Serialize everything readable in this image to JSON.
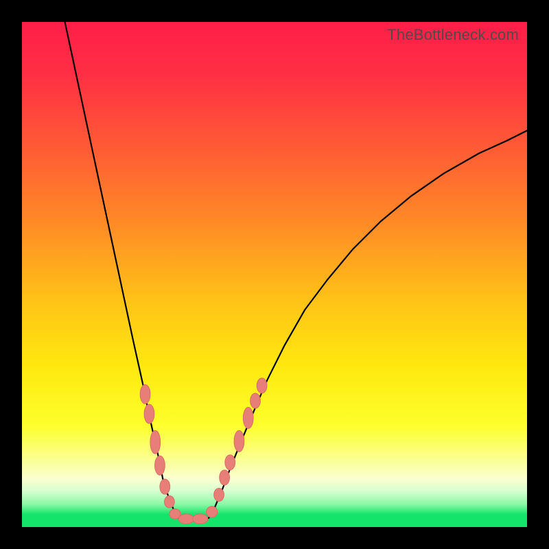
{
  "watermark": "TheBottleneck.com",
  "colors": {
    "frame": "#000000",
    "curve": "#000000",
    "marker_fill": "#e77f78",
    "marker_stroke": "#d86c65",
    "bottom_stripe": "#14e56a"
  },
  "gradient_stops": [
    {
      "offset": 0.0,
      "color": "#ff1e48"
    },
    {
      "offset": 0.1,
      "color": "#ff2e44"
    },
    {
      "offset": 0.25,
      "color": "#ff5b35"
    },
    {
      "offset": 0.4,
      "color": "#ff8b26"
    },
    {
      "offset": 0.55,
      "color": "#ffc217"
    },
    {
      "offset": 0.68,
      "color": "#ffe80e"
    },
    {
      "offset": 0.8,
      "color": "#fdff2c"
    },
    {
      "offset": 0.875,
      "color": "#fbffa0"
    },
    {
      "offset": 0.905,
      "color": "#fbffd2"
    },
    {
      "offset": 0.93,
      "color": "#d4ffce"
    },
    {
      "offset": 0.955,
      "color": "#8af9a6"
    },
    {
      "offset": 0.975,
      "color": "#14e56a"
    },
    {
      "offset": 1.0,
      "color": "#14e56a"
    }
  ],
  "chart_data": {
    "type": "line",
    "title": "",
    "xlabel": "",
    "ylabel": "",
    "xlim": [
      0,
      1
    ],
    "ylim": [
      0,
      1
    ],
    "series": [
      {
        "name": "left-branch",
        "x": [
          0.085,
          0.1,
          0.115,
          0.13,
          0.145,
          0.16,
          0.175,
          0.19,
          0.205,
          0.22,
          0.23,
          0.24,
          0.25,
          0.26,
          0.27,
          0.275,
          0.28,
          0.29,
          0.3,
          0.31
        ],
        "y": [
          1.0,
          0.93,
          0.86,
          0.79,
          0.72,
          0.65,
          0.58,
          0.51,
          0.44,
          0.37,
          0.325,
          0.28,
          0.23,
          0.185,
          0.14,
          0.115,
          0.09,
          0.06,
          0.035,
          0.018
        ]
      },
      {
        "name": "floor",
        "x": [
          0.31,
          0.34,
          0.37
        ],
        "y": [
          0.018,
          0.015,
          0.018
        ]
      },
      {
        "name": "right-branch",
        "x": [
          0.37,
          0.38,
          0.395,
          0.41,
          0.43,
          0.455,
          0.485,
          0.52,
          0.56,
          0.605,
          0.655,
          0.71,
          0.77,
          0.835,
          0.905,
          0.96,
          1.0
        ],
        "y": [
          0.018,
          0.035,
          0.07,
          0.11,
          0.16,
          0.22,
          0.29,
          0.36,
          0.43,
          0.49,
          0.55,
          0.605,
          0.655,
          0.7,
          0.74,
          0.765,
          0.785
        ]
      }
    ],
    "markers": [
      {
        "x": 0.244,
        "y": 0.263,
        "rx": 0.01,
        "ry": 0.019
      },
      {
        "x": 0.252,
        "y": 0.224,
        "rx": 0.01,
        "ry": 0.019
      },
      {
        "x": 0.264,
        "y": 0.168,
        "rx": 0.01,
        "ry": 0.023
      },
      {
        "x": 0.273,
        "y": 0.122,
        "rx": 0.01,
        "ry": 0.019
      },
      {
        "x": 0.283,
        "y": 0.08,
        "rx": 0.01,
        "ry": 0.015
      },
      {
        "x": 0.292,
        "y": 0.05,
        "rx": 0.01,
        "ry": 0.012
      },
      {
        "x": 0.303,
        "y": 0.026,
        "rx": 0.011,
        "ry": 0.01
      },
      {
        "x": 0.325,
        "y": 0.016,
        "rx": 0.015,
        "ry": 0.01
      },
      {
        "x": 0.353,
        "y": 0.016,
        "rx": 0.015,
        "ry": 0.01
      },
      {
        "x": 0.376,
        "y": 0.03,
        "rx": 0.011,
        "ry": 0.011
      },
      {
        "x": 0.39,
        "y": 0.064,
        "rx": 0.01,
        "ry": 0.013
      },
      {
        "x": 0.401,
        "y": 0.098,
        "rx": 0.01,
        "ry": 0.015
      },
      {
        "x": 0.412,
        "y": 0.128,
        "rx": 0.01,
        "ry": 0.015
      },
      {
        "x": 0.43,
        "y": 0.17,
        "rx": 0.01,
        "ry": 0.021
      },
      {
        "x": 0.448,
        "y": 0.216,
        "rx": 0.01,
        "ry": 0.021
      },
      {
        "x": 0.462,
        "y": 0.25,
        "rx": 0.01,
        "ry": 0.015
      },
      {
        "x": 0.475,
        "y": 0.28,
        "rx": 0.01,
        "ry": 0.015
      }
    ]
  }
}
